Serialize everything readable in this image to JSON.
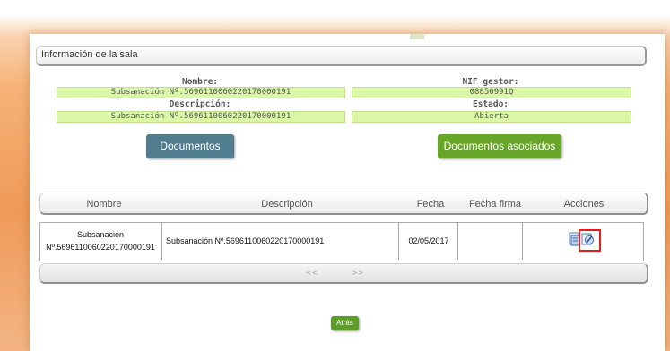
{
  "section": {
    "title": "Información de la sala"
  },
  "fields": {
    "nombre_label": "Nombre:",
    "nombre_value": "Subsanación Nº.5696110060220170000191",
    "descripcion_label": "Descripción:",
    "descripcion_value": "Subsanación Nº.5696110060220170000191",
    "nif_label": "NIF gestor:",
    "nif_value": "08850991Q",
    "estado_label": "Estado:",
    "estado_value": "Abierta"
  },
  "buttons": {
    "documentos": "Documentos",
    "documentos_asociados": "Documentos asociados",
    "atras": "Atrás"
  },
  "table": {
    "headers": [
      "Nombre",
      "Descripción",
      "Fecha",
      "Fecha firma",
      "Acciones"
    ],
    "rows": [
      {
        "nombre_line1": "Subsanación",
        "nombre_line2": "Nº.5696110060220170000191",
        "descripcion": "Subsanación Nº.5696110060220170000191",
        "fecha": "02/05/2017",
        "fecha_firma": ""
      }
    ],
    "actions_icons": [
      "view-document-icon",
      "edit-document-icon"
    ]
  },
  "pager": {
    "prev": "<<",
    "next": ">>"
  },
  "colors": {
    "field_bg": "#d9f7a6",
    "documentos_btn": "#4f7d8d",
    "asociados_btn": "#68a629",
    "highlight": "#e81c1c"
  }
}
